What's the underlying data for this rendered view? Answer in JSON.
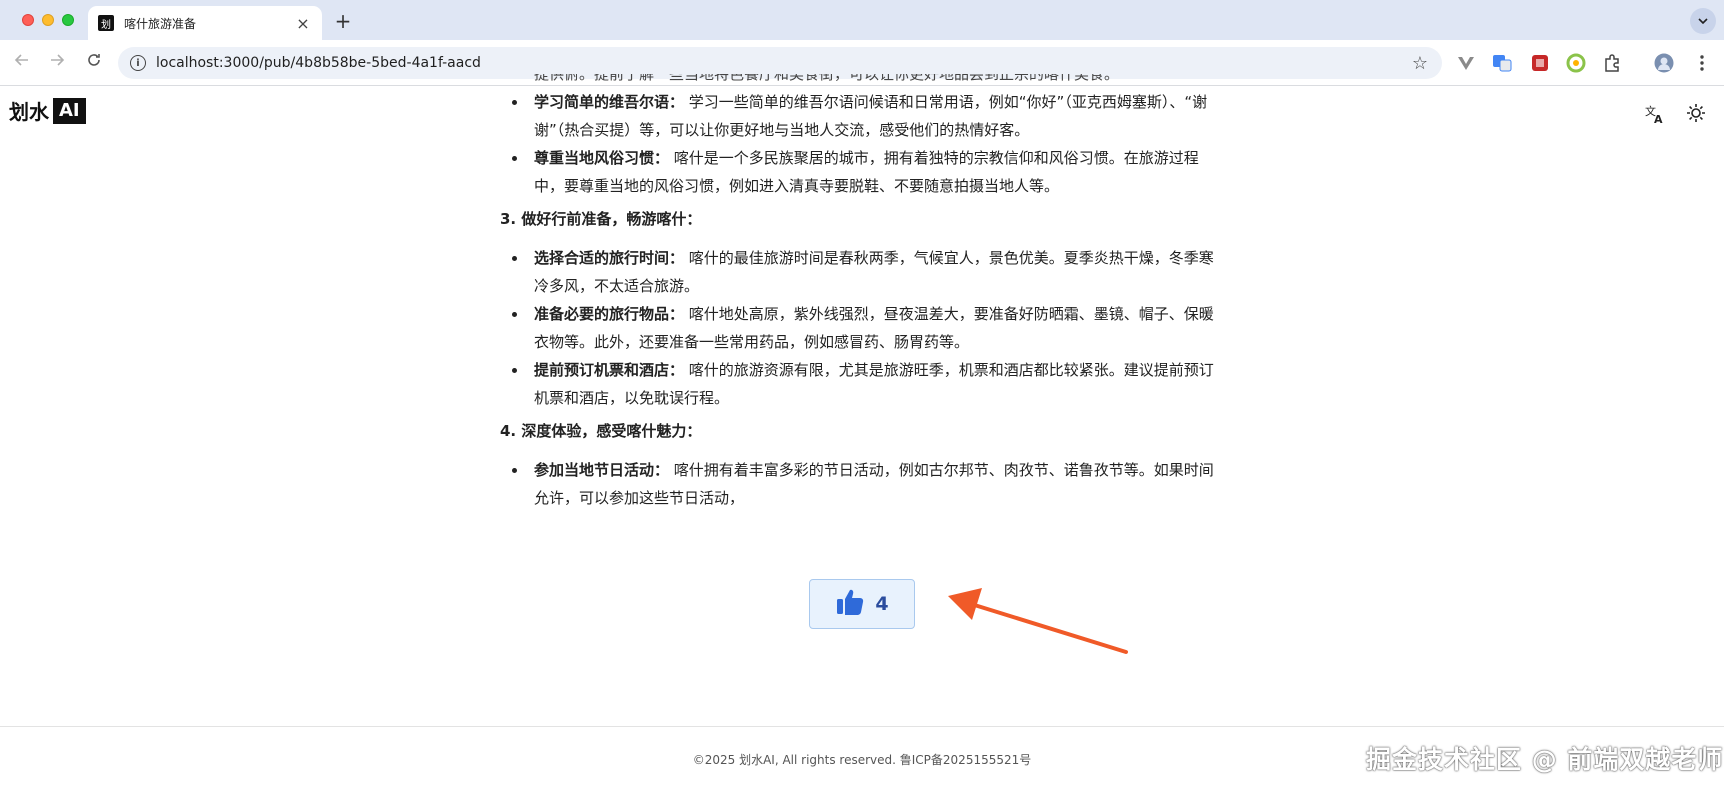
{
  "browser": {
    "tab_title": "喀什旅游准备",
    "tab_favicon": "划",
    "url": "localhost:3000/pub/4b8b58be-5bed-4a1f-aacd"
  },
  "site": {
    "logo_text": "划水",
    "logo_badge": "AI"
  },
  "article": {
    "cut_line": "提供俯。提前了解一些当地特色餐厅和美食街，可以让你更好地品尝到正宗的喀什美食。",
    "section2_items": [
      {
        "bold": "学习简单的维吾尔语：",
        "text": " 学习一些简单的维吾尔语问候语和日常用语，例如“你好”（亚克西姆塞斯）、“谢谢”（热合买提）等，可以让你更好地与当地人交流，感受他们的热情好客。"
      },
      {
        "bold": "尊重当地风俗习惯：",
        "text": " 喀什是一个多民族聚居的城市，拥有着独特的宗教信仰和风俗习惯。在旅游过程中，要尊重当地的风俗习惯，例如进入清真寺要脱鞋、不要随意拍摄当地人等。"
      }
    ],
    "heading3": "3. 做好行前准备，畅游喀什：",
    "section3_items": [
      {
        "bold": "选择合适的旅行时间：",
        "text": " 喀什的最佳旅游时间是春秋两季，气候宜人，景色优美。夏季炎热干燥，冬季寒冷多风，不太适合旅游。"
      },
      {
        "bold": "准备必要的旅行物品：",
        "text": " 喀什地处高原，紫外线强烈，昼夜温差大，要准备好防晒霜、墨镜、帽子、保暖衣物等。此外，还要准备一些常用药品，例如感冒药、肠胃药等。"
      },
      {
        "bold": "提前预订机票和酒店：",
        "text": " 喀什的旅游资源有限，尤其是旅游旺季，机票和酒店都比较紧张。建议提前预订机票和酒店，以免耽误行程。"
      }
    ],
    "heading4": "4. 深度体验，感受喀什魅力：",
    "section4_items": [
      {
        "bold": "参加当地节日活动：",
        "text": " 喀什拥有着丰富多彩的节日活动，例如古尔邦节、肉孜节、诺鲁孜节等。如果时间允许，可以参加这些节日活动，"
      }
    ]
  },
  "like": {
    "count": "4"
  },
  "footer": {
    "text": "©2025 划水AI, All rights reserved. 鲁ICP备2025155521号"
  },
  "watermark": "掘金技术社区 @ 前端双越老师",
  "colors": {
    "accent": "#2b4d9e",
    "like_bg": "#e8f2fd",
    "arrow": "#f05a28"
  }
}
